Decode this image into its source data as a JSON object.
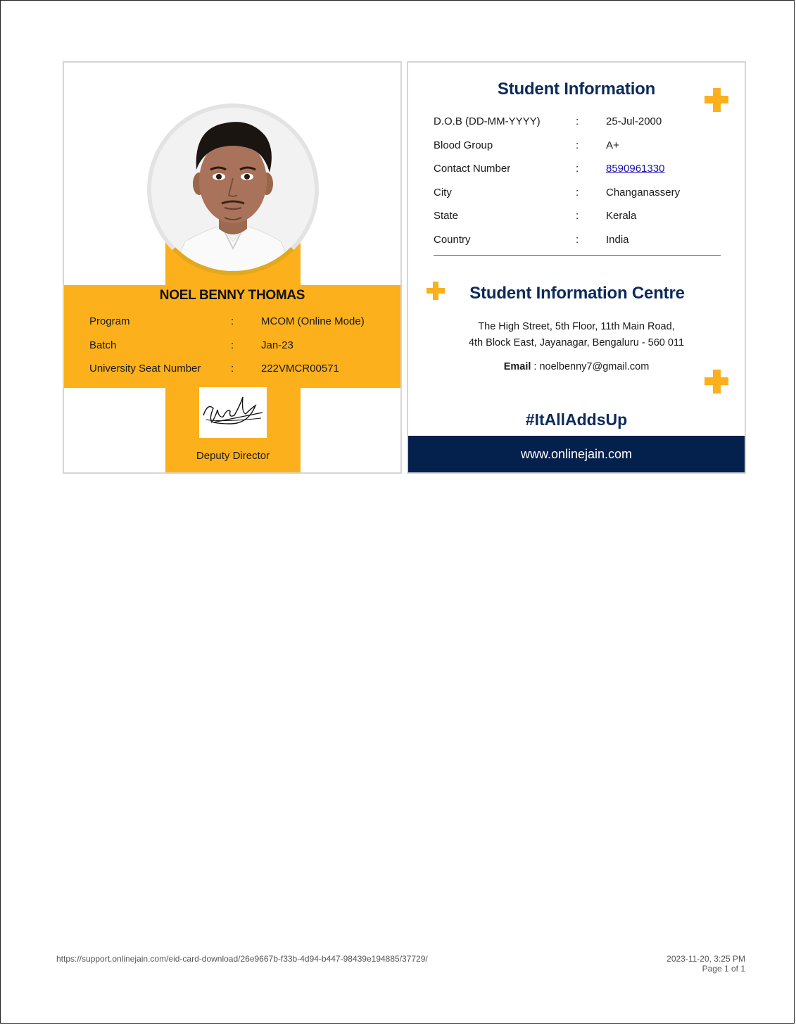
{
  "front": {
    "name": "NOEL BENNY THOMAS",
    "rows": [
      {
        "label": "Program",
        "sep": ":",
        "value": "MCOM (Online Mode)"
      },
      {
        "label": "Batch",
        "sep": ":",
        "value": "Jan-23"
      },
      {
        "label": "University Seat Number",
        "sep": ":",
        "value": "222VMCR00571"
      }
    ],
    "signatory": "Deputy Director"
  },
  "back": {
    "title": "Student Information",
    "rows": [
      {
        "label": "D.O.B (DD-MM-YYYY)",
        "sep": ":",
        "value": "25-Jul-2000"
      },
      {
        "label": "Blood Group",
        "sep": ":",
        "value": "A+"
      },
      {
        "label": "Contact Number",
        "sep": ":",
        "value": "8590961330"
      },
      {
        "label": "City",
        "sep": ":",
        "value": "Changanassery"
      },
      {
        "label": "State",
        "sep": ":",
        "value": "Kerala"
      },
      {
        "label": "Country",
        "sep": ":",
        "value": "India"
      }
    ],
    "centre_title": "Student Information Centre",
    "address_line1": "The High Street, 5th Floor, 11th Main Road,",
    "address_line2": "4th Block East, Jayanagar, Bengaluru - 560 011",
    "email_label": "Email",
    "email_value": " : noelbenny7@gmail.com",
    "hashtag": "#ItAllAddsUp",
    "website": "www.onlinejain.com"
  },
  "print_footer": {
    "url": "https://support.onlinejain.com/eid-card-download/26e9667b-f33b-4d94-b447-98439e194885/37729/",
    "datetime": "2023-11-20, 3:25 PM",
    "page": "Page 1 of 1"
  },
  "colors": {
    "accent": "#fbb01c",
    "navy": "#0c2a5b",
    "footer_bar": "#04204d",
    "link": "#1a0dab"
  }
}
